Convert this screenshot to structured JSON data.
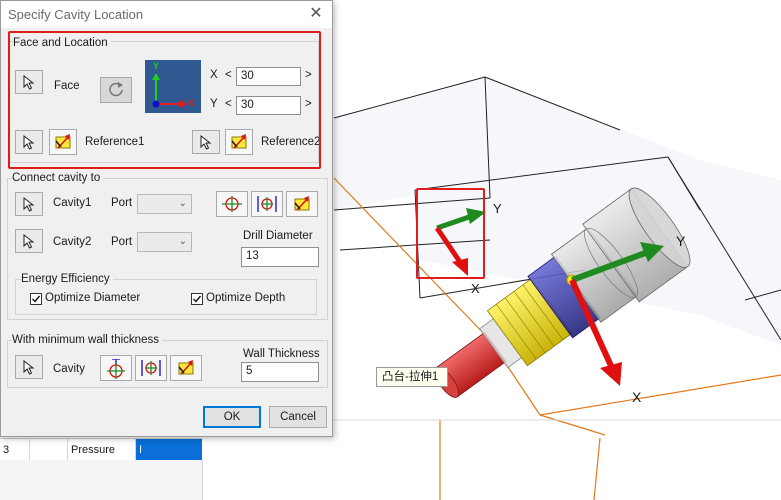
{
  "dialog": {
    "title": "Specify Cavity Location",
    "close_glyph": "✕",
    "face_location": {
      "group_label": "Face and Location",
      "face_label": "Face",
      "rotate_icon": "rotate-icon",
      "axis_preview": {
        "y_label": "Y",
        "x_label": "X"
      },
      "x_label": "X",
      "y_label": "Y",
      "x_value": "30",
      "y_value": "30",
      "decrement": "<",
      "increment": ">",
      "reference1_label": "Reference1",
      "reference2_label": "Reference2"
    },
    "connect": {
      "group_label": "Connect cavity to",
      "cavity1_label": "Cavity1",
      "cavity2_label": "Cavity2",
      "port_label": "Port",
      "port1_value": "",
      "port2_value": "",
      "drill_diameter_label": "Drill Diameter",
      "drill_diameter_value": "13"
    },
    "energy": {
      "group_label": "Energy Efficiency",
      "optimize_diameter_label": "Optimize Diameter",
      "optimize_diameter_checked": true,
      "optimize_depth_label": "Optimize Depth",
      "optimize_depth_checked": true
    },
    "wall": {
      "group_label": "With minimum wall thickness",
      "cavity_label": "Cavity",
      "wall_thickness_label": "Wall Thickness",
      "wall_thickness_value": "5"
    },
    "ok_label": "OK",
    "cancel_label": "Cancel"
  },
  "background_table": {
    "row_number": "3",
    "cell_type": "Pressure",
    "cell_selected": "I"
  },
  "viewport": {
    "tooltip": "凸台-拉伸1",
    "local_axis": {
      "y_label": "Y",
      "x_label": "X"
    },
    "part_axis": {
      "y_label": "Y",
      "x_label": "X"
    }
  },
  "colors": {
    "highlight_red": "#e21c1c",
    "axis_green": "#1f8a1f",
    "axis_red": "#e01010",
    "edge_orange": "#e07a1a",
    "selection_blue": "#0a6fd8"
  }
}
